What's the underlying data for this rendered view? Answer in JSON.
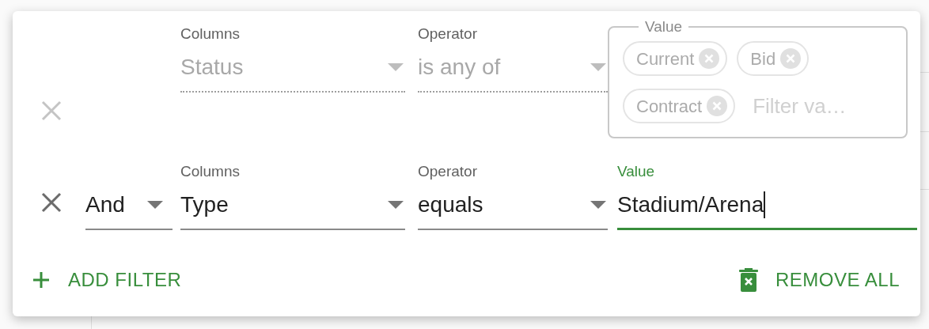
{
  "filters": [
    {
      "kind": "chips",
      "disabled": true,
      "column_label": "Columns",
      "column": "Status",
      "operator_label": "Operator",
      "operator": "is any of",
      "value_label": "Value",
      "chips": [
        "Current",
        "Bid",
        "Contract"
      ],
      "placeholder": "Filter va…"
    },
    {
      "kind": "text",
      "disabled": false,
      "focused": true,
      "logic": "And",
      "column_label": "Columns",
      "column": "Type",
      "operator_label": "Operator",
      "operator": "equals",
      "value_label": "Value",
      "value": "Stadium/Arena"
    }
  ],
  "actions": {
    "add_filter": "ADD FILTER",
    "remove_all": "REMOVE ALL"
  }
}
